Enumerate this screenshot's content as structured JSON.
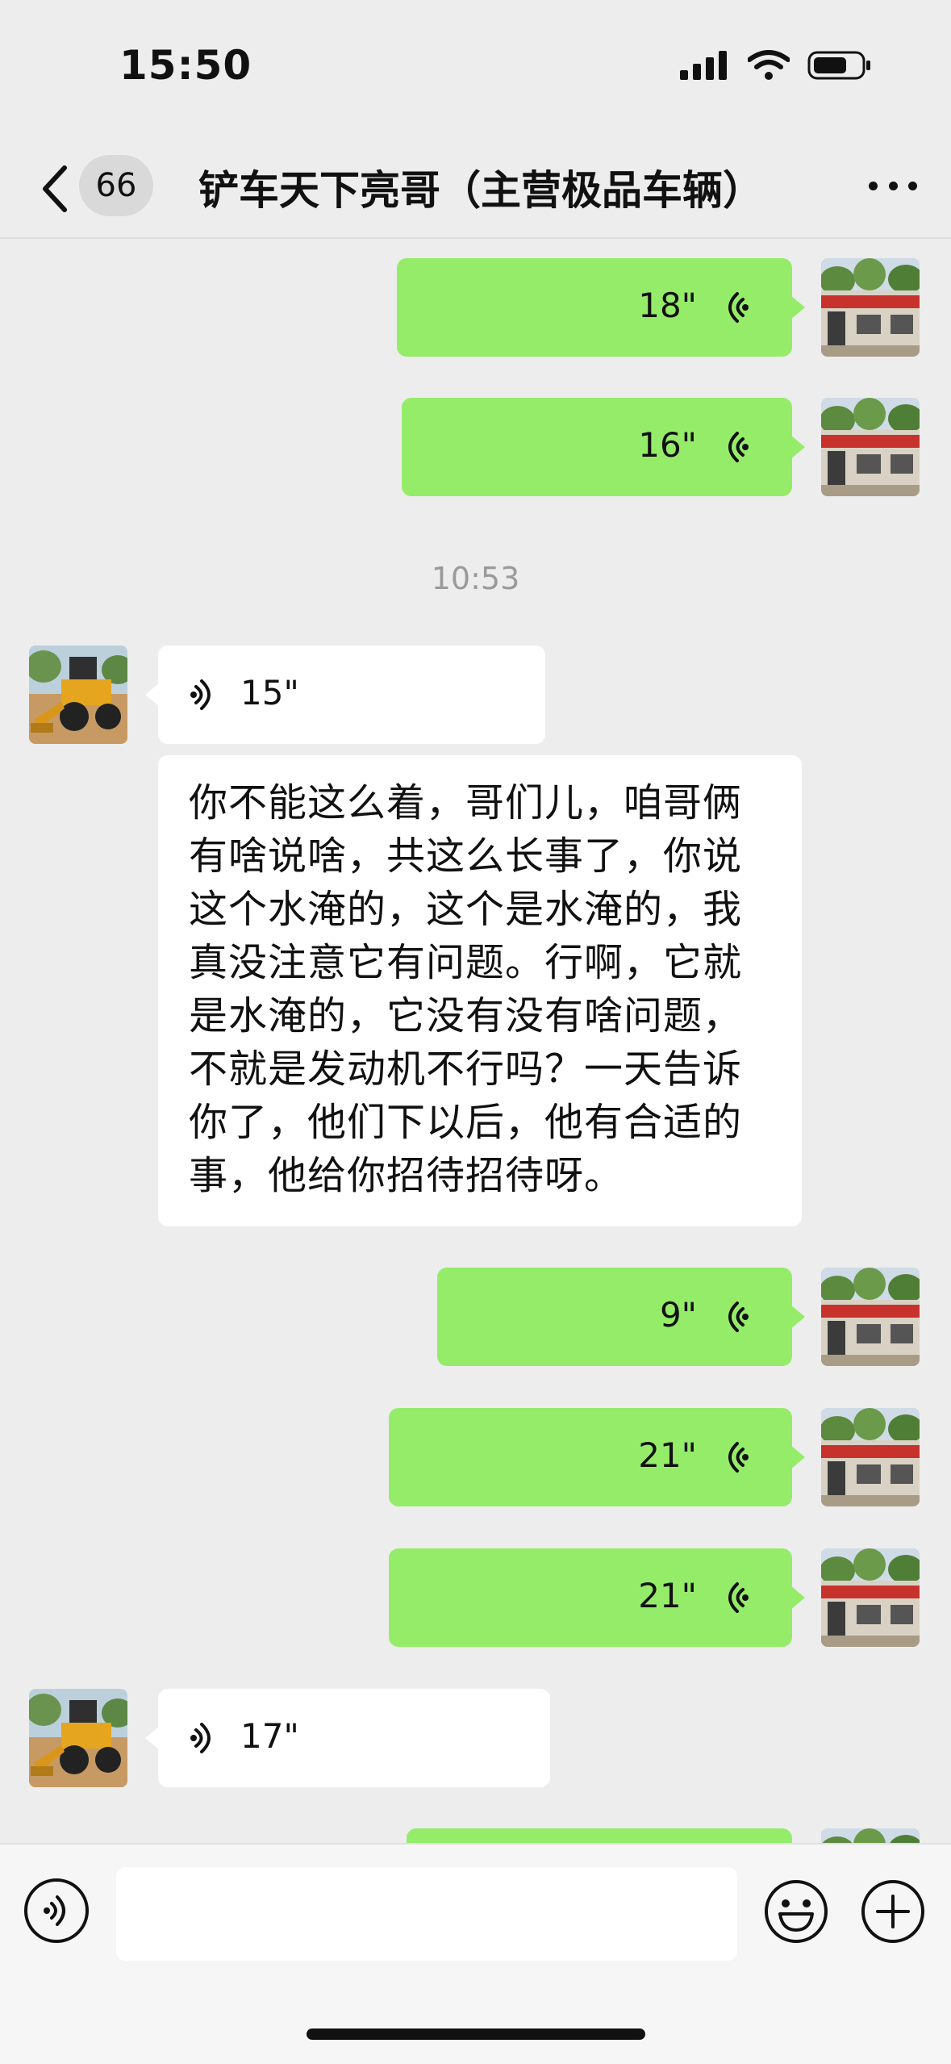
{
  "status_bar": {
    "time": "15:50"
  },
  "header": {
    "unread_badge": "66",
    "title": "铲车天下亮哥（主营极品车辆）"
  },
  "messages": [
    {
      "side": "out",
      "type": "voice",
      "duration": "18\""
    },
    {
      "side": "out",
      "type": "voice",
      "duration": "16\""
    },
    {
      "type": "timestamp",
      "text": "10:53"
    },
    {
      "side": "in",
      "type": "voice",
      "duration": "15\""
    },
    {
      "side": "in",
      "type": "transcript",
      "text": "你不能这么着，哥们儿，咱哥俩有啥说啥，共这么长事了，你说这个水淹的，这个是水淹的，我真没注意它有问题。行啊，它就是水淹的，它没有没有啥问题，不就是发动机不行吗？一天告诉你了，他们下以后，他有合适的事，他给你招待招待呀。"
    },
    {
      "side": "out",
      "type": "voice",
      "duration": "9\""
    },
    {
      "side": "out",
      "type": "voice",
      "duration": "21\""
    },
    {
      "side": "out",
      "type": "voice",
      "duration": "21\""
    },
    {
      "side": "in",
      "type": "voice",
      "duration": "17\""
    }
  ],
  "transcript_lines": [
    "你不能这么着，哥们儿，咱哥俩",
    "有啥说啥，共这么长事了，你说",
    "这个水淹的，这个是水淹的，我",
    "真没注意它有问题。行啊，它就",
    "是水淹的，它没有没有啥问题，",
    "不就是发动机不行吗？一天告诉",
    "你了，他们下以后，他有合适的",
    "事，他给你招待招待呀。"
  ],
  "input": {
    "value": ""
  },
  "colors": {
    "outgoing_bubble": "#95ec69",
    "incoming_bubble": "#ffffff",
    "background": "#ededed"
  }
}
